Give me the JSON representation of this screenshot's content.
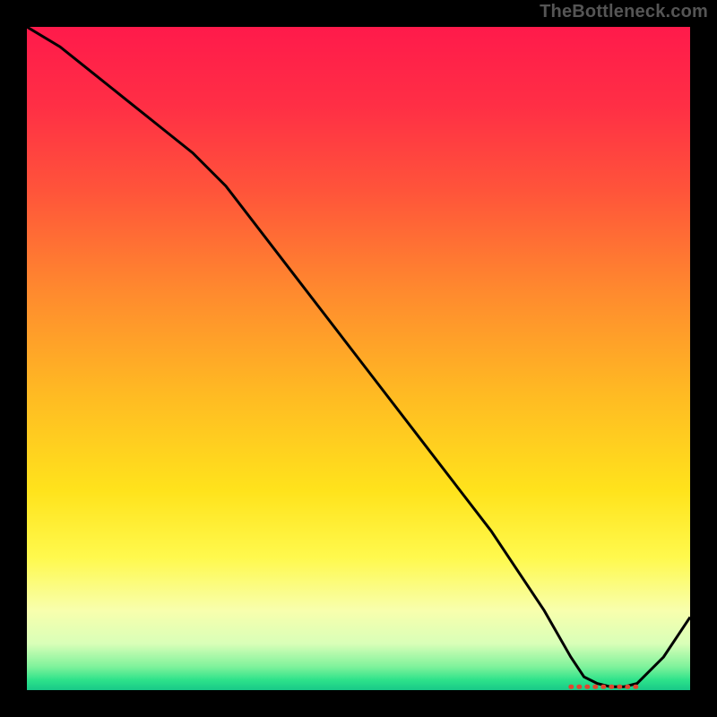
{
  "attribution": "TheBottleneck.com",
  "gradient_stops": [
    {
      "offset": 0,
      "color": "#ff1a4b"
    },
    {
      "offset": 0.12,
      "color": "#ff2f45"
    },
    {
      "offset": 0.25,
      "color": "#ff553a"
    },
    {
      "offset": 0.4,
      "color": "#ff8a2e"
    },
    {
      "offset": 0.55,
      "color": "#ffb923"
    },
    {
      "offset": 0.7,
      "color": "#ffe31c"
    },
    {
      "offset": 0.8,
      "color": "#fff94d"
    },
    {
      "offset": 0.88,
      "color": "#f8ffad"
    },
    {
      "offset": 0.93,
      "color": "#d9ffb8"
    },
    {
      "offset": 0.965,
      "color": "#7ef29b"
    },
    {
      "offset": 0.985,
      "color": "#2de28a"
    },
    {
      "offset": 1.0,
      "color": "#18c888"
    }
  ],
  "chart_data": {
    "type": "line",
    "title": "",
    "xlabel": "",
    "ylabel": "",
    "x": [
      0,
      5,
      10,
      15,
      20,
      25,
      30,
      40,
      50,
      60,
      70,
      78,
      82,
      84,
      86,
      88,
      90,
      92,
      96,
      100
    ],
    "values": [
      100,
      97,
      93,
      89,
      85,
      81,
      76,
      63,
      50,
      37,
      24,
      12,
      5,
      2,
      1,
      0.5,
      0.5,
      1,
      5,
      11
    ],
    "marker_segment": {
      "x_start": 82,
      "x_end": 92,
      "y": 0.5
    },
    "xlim": [
      0,
      100
    ],
    "ylim": [
      0,
      100
    ],
    "curve_color": "#000000",
    "marker_color": "#e2452f"
  }
}
